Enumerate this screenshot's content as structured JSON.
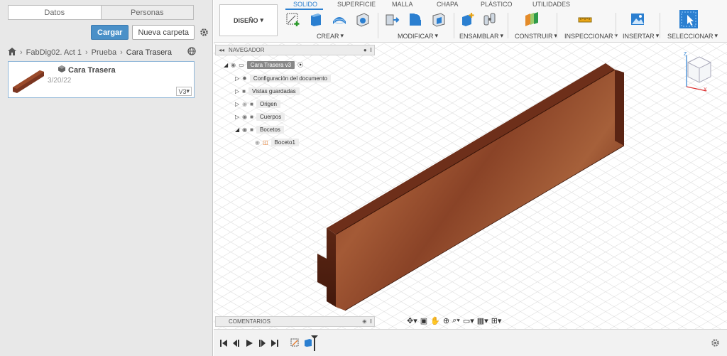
{
  "left_panel": {
    "tabs": [
      {
        "label": "Datos",
        "active": true
      },
      {
        "label": "Personas",
        "active": false
      }
    ],
    "upload_label": "Cargar",
    "new_folder_label": "Nueva carpeta",
    "breadcrumb": [
      "FabDig02. Act 1",
      "Prueba",
      "Cara Trasera"
    ],
    "file": {
      "name": "Cara Trasera",
      "date": "3/20/22",
      "version": "V3"
    }
  },
  "toolbar": {
    "design_label": "DISEÑO",
    "workspace_tabs": [
      {
        "label": "SOLIDO",
        "active": true
      },
      {
        "label": "SUPERFICIE",
        "active": false
      },
      {
        "label": "MALLA",
        "active": false
      },
      {
        "label": "CHAPA",
        "active": false
      },
      {
        "label": "PLÁSTICO",
        "active": false
      },
      {
        "label": "UTILIDADES",
        "active": false
      }
    ],
    "groups": [
      "CREAR",
      "MODIFICAR",
      "ENSAMBLAR",
      "CONSTRUIR",
      "INSPECCIONAR",
      "INSERTAR",
      "SELECCIONAR"
    ]
  },
  "browser": {
    "title": "NAVEGADOR",
    "root": "Cara Trasera v3",
    "items": [
      "Configuración del documento",
      "Vistas guardadas",
      "Origen",
      "Cuerpos",
      "Bocetos",
      "Boceto1"
    ]
  },
  "comments": {
    "title": "COMENTARIOS"
  },
  "viewcube": {
    "z_label": "Z",
    "x_label": "X"
  },
  "colors": {
    "accent": "#2b7fd0",
    "wood": "#8a3f22",
    "primary_button": "#4a90c8"
  }
}
